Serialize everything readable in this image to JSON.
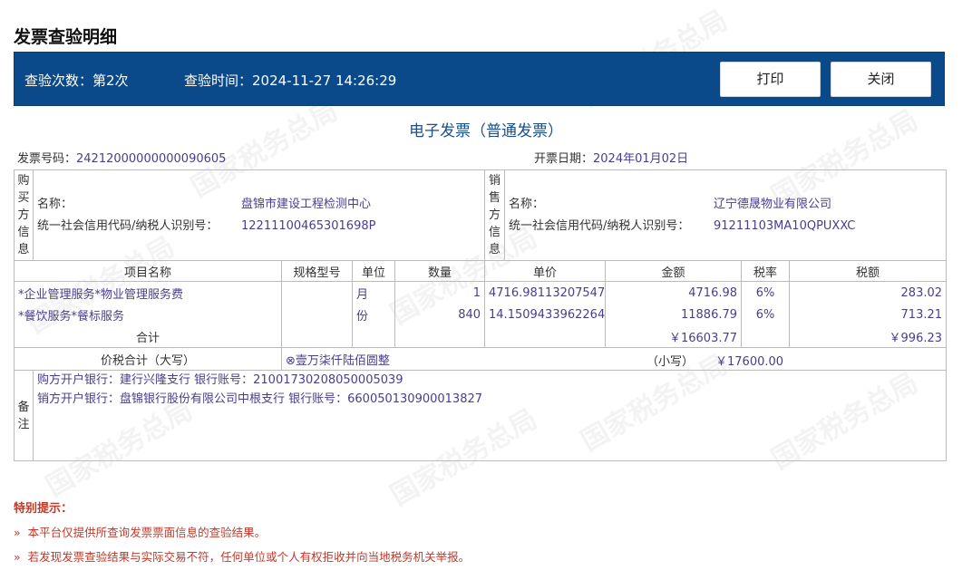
{
  "page": {
    "title": "发票查验明细"
  },
  "header": {
    "check_count": "查验次数：第2次",
    "check_time": "查验时间：2024-11-27 14:26:29",
    "print_label": "打印",
    "close_label": "关闭"
  },
  "invoice": {
    "type_title": "电子发票（普通发票）",
    "number_label": "发票号码：",
    "number": "24212000000000090605",
    "date_label": "开票日期：",
    "date": "2024年01月02日",
    "buyer": {
      "section_label": [
        "购",
        "买",
        "方",
        "信",
        "息"
      ],
      "name_label": "名称：",
      "name": "盘锦市建设工程检测中心",
      "tax_id_label": "统一社会信用代码/纳税人识别号：",
      "tax_id": "12211100465301698P"
    },
    "seller": {
      "section_label": [
        "销",
        "售",
        "方",
        "信",
        "息"
      ],
      "name_label": "名称：",
      "name": "辽宁德晟物业有限公司",
      "tax_id_label": "统一社会信用代码/纳税人识别号：",
      "tax_id": "91211103MA10QPUXXC"
    },
    "columns": [
      "项目名称",
      "规格型号",
      "单位",
      "数量",
      "单价",
      "金额",
      "税率",
      "税额"
    ],
    "items": [
      {
        "name": "*企业管理服务*物业管理服务费",
        "spec": "",
        "unit": "月",
        "qty": "1",
        "price": "4716.98113207547",
        "amount": "4716.98",
        "rate": "6%",
        "tax": "283.02"
      },
      {
        "name": "*餐饮服务*餐标服务",
        "spec": "",
        "unit": "份",
        "qty": "840",
        "price": "14.1509433962264",
        "amount": "11886.79",
        "rate": "6%",
        "tax": "713.21"
      }
    ],
    "subtotal_label": "合计",
    "subtotal_amount": "￥16603.77",
    "subtotal_tax": "￥996.23",
    "total_label": "价税合计（大写）",
    "total_upper": "⊗壹万柒仟陆佰圆整",
    "total_small_label": "（小写）",
    "total_small": "￥17600.00",
    "notes_label": [
      "备",
      "注"
    ],
    "notes": [
      "购方开户银行：建行兴隆支行 银行账号：21001730208050005039",
      "销方开户银行：盘锦银行股份有限公司中根支行 银行账号：660050130900013827"
    ]
  },
  "tips": {
    "title": "特别提示：",
    "items": [
      "本平台仅提供所查询发票票面信息的查验结果。",
      "若发现发票查验结果与实际交易不符，任何单位或个人有权拒收并向当地税务机关举报。"
    ],
    "arrow": "»"
  },
  "watermark": "国家税务总局"
}
